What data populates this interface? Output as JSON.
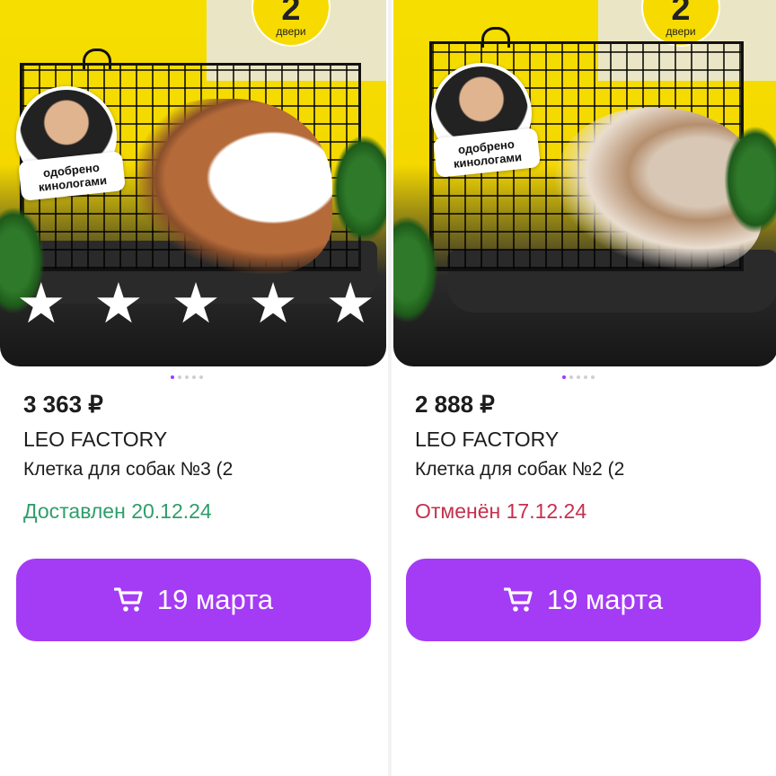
{
  "colors": {
    "accent": "#a43bf5",
    "delivered": "#2e9e6b",
    "cancelled": "#c4304f",
    "dot_active": "#a238ff",
    "dot_inactive": "#cfcfd4"
  },
  "products": [
    {
      "image": {
        "badge_number": "2",
        "badge_label": "двери",
        "sticker_line1": "одобрено",
        "sticker_line2": "кинологами",
        "rating_stars": 5,
        "carousel_pages": 5,
        "carousel_active": 0
      },
      "price": "3 363 ₽",
      "brand": "LEO FACTORY",
      "title": "Клетка для собак №3 (2",
      "status": "Доставлен 20.12.24",
      "status_type": "delivered",
      "button_label": "19 марта",
      "button_icon": "cart-icon"
    },
    {
      "image": {
        "badge_number": "2",
        "badge_label": "двери",
        "sticker_line1": "одобрено",
        "sticker_line2": "кинологами",
        "carousel_pages": 5,
        "carousel_active": 0
      },
      "price": "2 888 ₽",
      "brand": "LEO FACTORY",
      "title": "Клетка для собак №2 (2",
      "status": "Отменён 17.12.24",
      "status_type": "cancelled",
      "button_label": "19 марта",
      "button_icon": "cart-icon"
    }
  ]
}
